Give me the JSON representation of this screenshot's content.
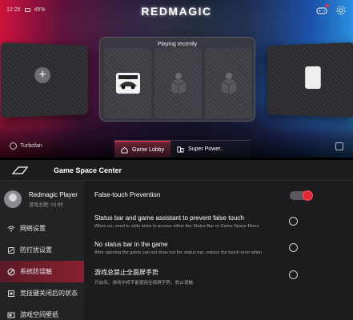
{
  "status": {
    "time": "12:25",
    "battery": "45%"
  },
  "brand": "REDMAGIC",
  "recent": {
    "title": "Playing recently"
  },
  "bottom_bar": {
    "turbo_label": "Turbofan",
    "tabs": [
      {
        "label": "Game Lobby",
        "active": true
      },
      {
        "label": "Super Power..",
        "active": false
      }
    ]
  },
  "settings": {
    "header_title": "Game Space Center",
    "profile": {
      "name": "Redmagic Player",
      "subtitle": "游戏主题: 0小时"
    },
    "sidebar": [
      {
        "label": "网络设置",
        "icon": "wifi-icon",
        "active": false
      },
      {
        "label": "防打扰设置",
        "icon": "no-disturb-icon",
        "active": false
      },
      {
        "label": "系统防误触",
        "icon": "touch-protect-icon",
        "active": true
      },
      {
        "label": "竞技键关闭后的状态",
        "icon": "key-icon",
        "active": false
      },
      {
        "label": "游戏空间壁纸",
        "icon": "wallpaper-icon",
        "active": false
      }
    ],
    "options": [
      {
        "title": "False-touch Prevention",
        "desc": "",
        "control": "toggle",
        "value": true
      },
      {
        "title": "Status bar and game assistant to prevent false touch",
        "desc": "When on, need to slide twice to access either the Status Bar or Game Space Menu",
        "control": "radio",
        "value": false
      },
      {
        "title": "No status bar in the game",
        "desc": "After opening the game can not draw out the status bar, reduce the touch error when",
        "control": "radio",
        "value": false
      },
      {
        "title": "游戏总禁止全面屏手势",
        "desc": "开启后，游戏中将不能使用全面屏手势，防止误触",
        "control": "radio",
        "value": false
      }
    ]
  },
  "colors": {
    "accent_red": "#e02a38",
    "accent_blue": "#2a8fe0",
    "panel_bg": "#1c1c1e"
  }
}
